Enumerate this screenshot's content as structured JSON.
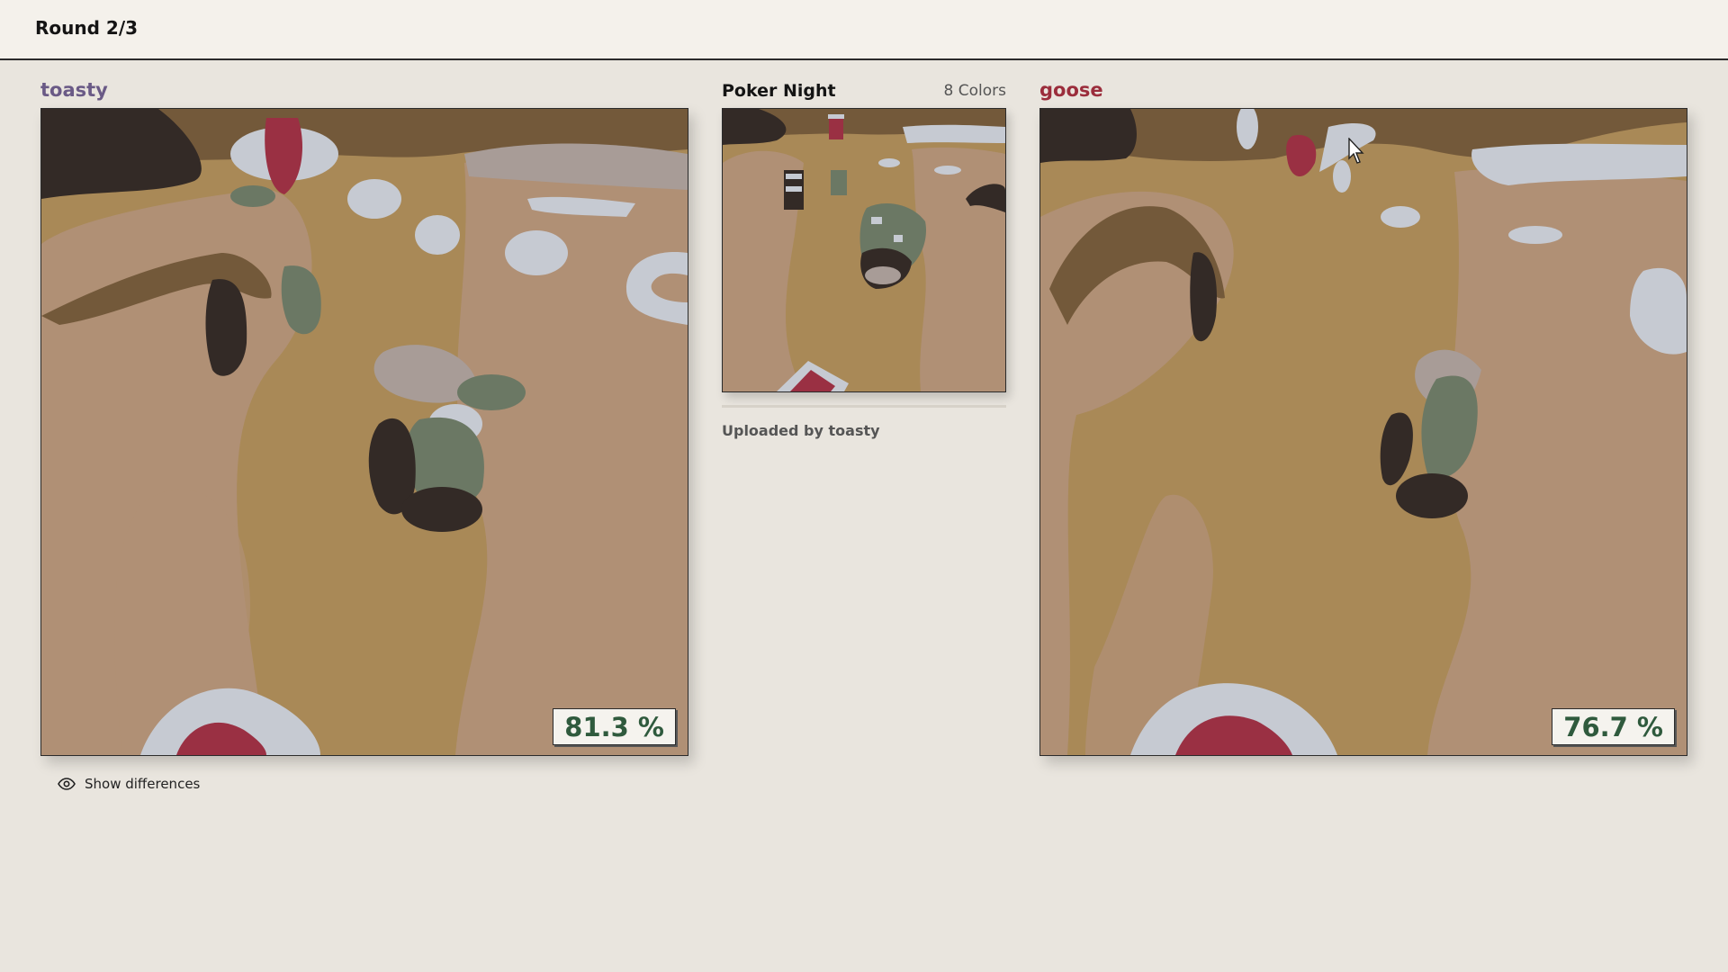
{
  "header": {
    "round": "Round 2/3"
  },
  "players": {
    "left": {
      "name": "toasty",
      "name_color": "#6a5a86",
      "score": "81.3 %"
    },
    "right": {
      "name": "goose",
      "name_color": "#9b2d3c",
      "score": "76.7 %"
    }
  },
  "reference": {
    "title": "Poker Night",
    "colors": "8 Colors",
    "uploaded_by": "Uploaded by toasty"
  },
  "controls": {
    "show_differences": "Show differences"
  },
  "icons": {
    "diff_icon": "eye-icon",
    "cursor": "mouse-pointer-icon"
  },
  "palette": {
    "dark_brown": "#332a26",
    "mid_brown": "#73593a",
    "tan": "#a98957",
    "light_tan": "#b09075",
    "gray_pink": "#a89c97",
    "light_blue": "#c6cad2",
    "red": "#9a3043",
    "sage": "#6b7864"
  }
}
